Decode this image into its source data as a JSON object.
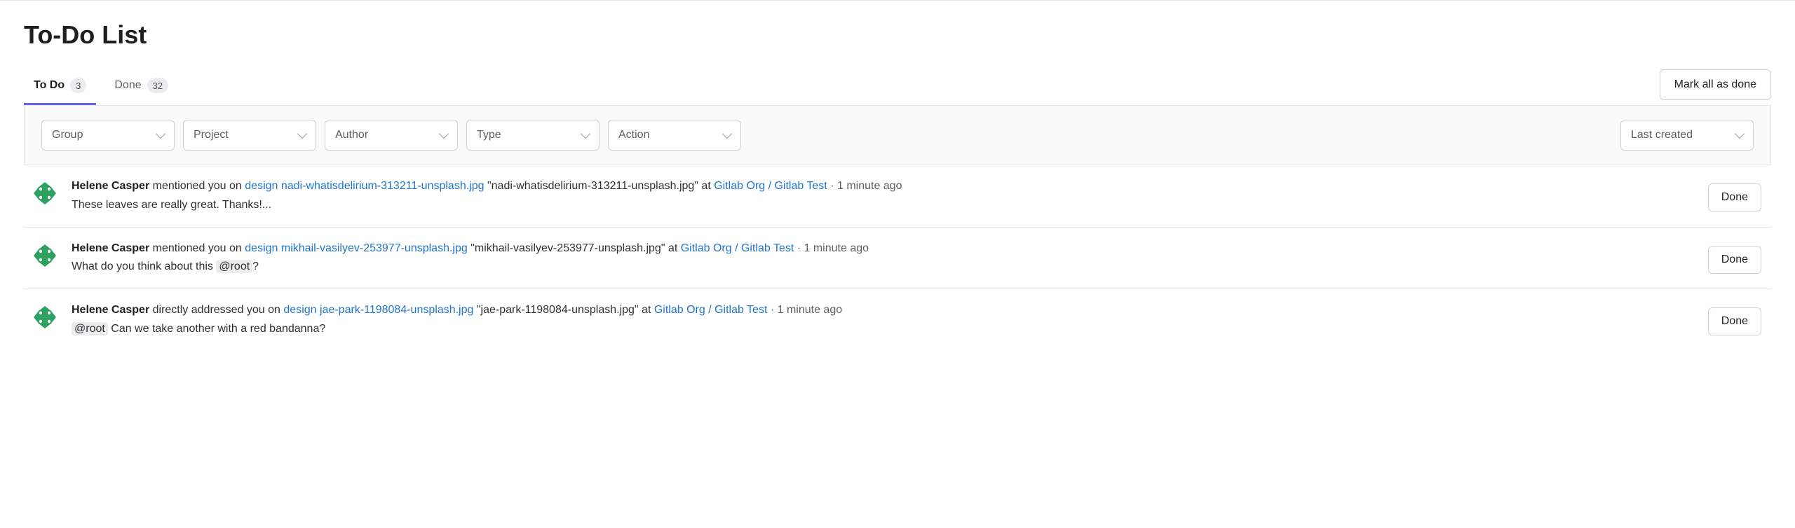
{
  "page": {
    "title": "To-Do List"
  },
  "tabs": {
    "todo": {
      "label": "To Do",
      "count": "3"
    },
    "done": {
      "label": "Done",
      "count": "32"
    }
  },
  "actions": {
    "mark_all": "Mark all as done",
    "done": "Done"
  },
  "filters": {
    "group": "Group",
    "project": "Project",
    "author": "Author",
    "type": "Type",
    "action": "Action"
  },
  "sort": {
    "label": "Last created"
  },
  "avatar_color": "#2da160",
  "items": [
    {
      "author": "Helene Casper",
      "verb": " mentioned you on ",
      "design_link": "design nadi-whatisdelirium-313211-unsplash.jpg",
      "quoted": " \"nadi-whatisdelirium-313211-unsplash.jpg\" at ",
      "project_link": "Gitlab Org / Gitlab Test",
      "sep": " · ",
      "time": "1 minute ago",
      "note_pre": "These leaves are really great. Thanks!...",
      "note_mention": "",
      "note_post": ""
    },
    {
      "author": "Helene Casper",
      "verb": " mentioned you on ",
      "design_link": "design mikhail-vasilyev-253977-unsplash.jpg",
      "quoted": " \"mikhail-vasilyev-253977-unsplash.jpg\" at ",
      "project_link": "Gitlab Org / Gitlab Test",
      "sep": " · ",
      "time": "1 minute ago",
      "note_pre": "What do you think about this ",
      "note_mention": "@root",
      "note_post": "?"
    },
    {
      "author": "Helene Casper",
      "verb": " directly addressed you on ",
      "design_link": "design jae-park-1198084-unsplash.jpg",
      "quoted": " \"jae-park-1198084-unsplash.jpg\" at ",
      "project_link": "Gitlab Org / Gitlab Test",
      "sep": " · ",
      "time": "1 minute ago",
      "note_pre": "",
      "note_mention": "@root",
      "note_post": " Can we take another with a red bandanna?"
    }
  ]
}
